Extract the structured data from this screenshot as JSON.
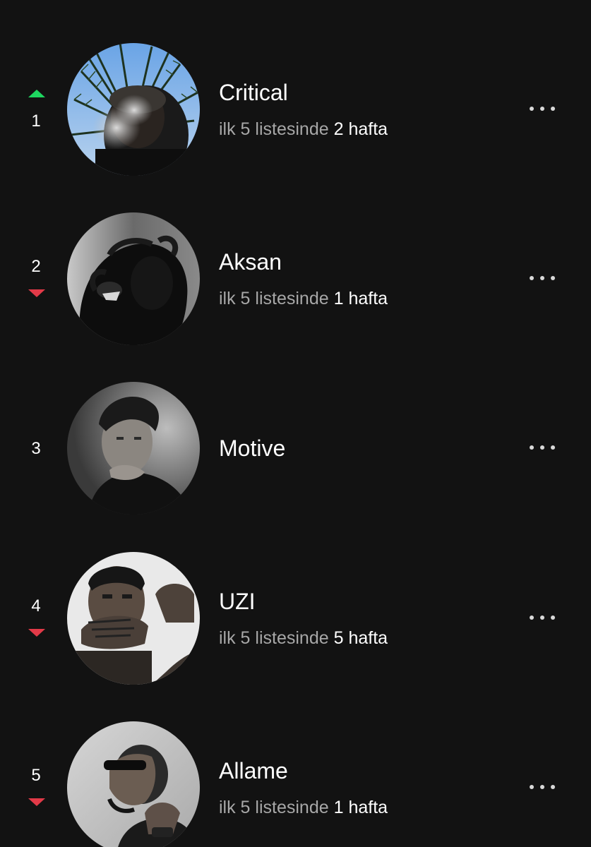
{
  "chart": {
    "entries": [
      {
        "rank": "1",
        "trend": "up",
        "title": "Critical",
        "sub_prefix": "ilk 5 listesinde",
        "sub_value": "2 hafta",
        "avatar": "artist-photo-palm-smoke"
      },
      {
        "rank": "2",
        "trend": "down",
        "title": "Aksan",
        "sub_prefix": "ilk 5 listesinde",
        "sub_value": "1 hafta",
        "avatar": "artist-photo-dark-mask"
      },
      {
        "rank": "3",
        "trend": "none",
        "title": "Motive",
        "sub_prefix": "",
        "sub_value": "",
        "avatar": "artist-photo-bw-portrait"
      },
      {
        "rank": "4",
        "trend": "down",
        "title": "UZI",
        "sub_prefix": "ilk 5 listesinde",
        "sub_value": "5 hafta",
        "avatar": "artist-photo-hand-over-mouth"
      },
      {
        "rank": "5",
        "trend": "down",
        "title": "Allame",
        "sub_prefix": "ilk 5 listesinde",
        "sub_value": "1 hafta",
        "avatar": "artist-photo-sunglasses-profile"
      }
    ]
  },
  "colors": {
    "background": "#121212",
    "trend_up": "#1ed760",
    "trend_down": "#e23a48",
    "muted_text": "#a7a7a7"
  },
  "icons": {
    "more": "more-options-icon",
    "up": "trend-up-icon",
    "down": "trend-down-icon"
  }
}
